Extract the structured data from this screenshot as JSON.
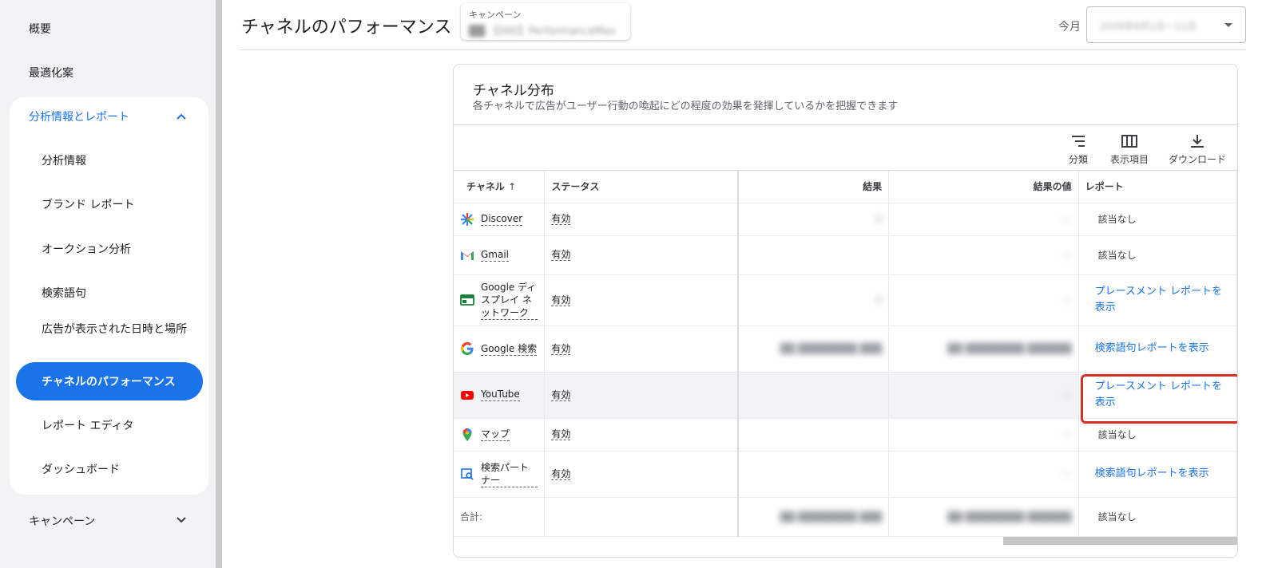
{
  "sidebar": {
    "overview": "概要",
    "recommendations": "最適化案",
    "group_header": "分析情報とレポート",
    "sub_items": [
      "分析情報",
      "ブランド レポート",
      "オークション分析",
      "検索語句",
      "広告が表示された日時と場所"
    ],
    "active_item": "チャネルのパフォーマンス",
    "sub_items_after": [
      "レポート エディタ",
      "ダッシュボード"
    ],
    "campaigns": "キャンペーン"
  },
  "header": {
    "title": "チャネルのパフォーマンス",
    "campaign_label": "キャンペーン",
    "month_label": "今月"
  },
  "card": {
    "title": "チャネル分布",
    "subtitle": "各チャネルで広告がユーザー行動の喚起にどの程度の効果を発揮しているかを把握できます",
    "tools": [
      "分類",
      "表示項目",
      "ダウンロード"
    ]
  },
  "table": {
    "headers": [
      "チャネル",
      "ステータス",
      "結果",
      "結果の値",
      "レポート"
    ],
    "rows": [
      {
        "channel": "Discover",
        "status": "有効",
        "report": "該当なし",
        "report_link": false
      },
      {
        "channel": "Gmail",
        "status": "有効",
        "report": "該当なし",
        "report_link": false
      },
      {
        "channel": "Google ディスプレイ ネットワーク",
        "status": "有効",
        "report": "プレースメント レポートを表示",
        "report_link": true
      },
      {
        "channel": "Google 検索",
        "status": "有効",
        "report": "検索語句レポートを表示",
        "report_link": true
      },
      {
        "channel": "YouTube",
        "status": "有効",
        "report": "プレースメント レポートを表示",
        "report_link": true
      },
      {
        "channel": "マップ",
        "status": "有効",
        "report": "該当なし",
        "report_link": false
      },
      {
        "channel": "検索パートナー",
        "status": "有効",
        "report": "検索語句レポートを表示",
        "report_link": true
      }
    ],
    "total_label": "合計:",
    "total_report": "該当なし"
  },
  "colors": {
    "accent": "#1a73e8",
    "highlight": "#d93025"
  }
}
